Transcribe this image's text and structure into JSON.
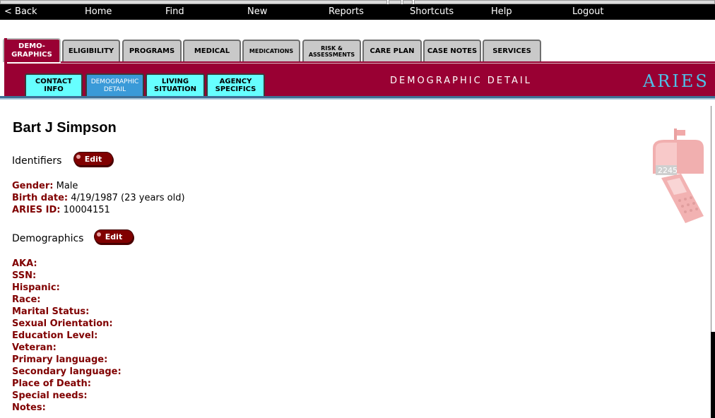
{
  "menubar": {
    "back": "< Back",
    "home": "Home",
    "find": "Find",
    "new": "New",
    "reports": "Reports",
    "shortcuts": "Shortcuts",
    "help": "Help",
    "logout": "Logout"
  },
  "tabs": {
    "demographics_1": "DEMO-",
    "demographics_2": "GRAPHICS",
    "eligibility": "ELIGIBILITY",
    "programs": "PROGRAMS",
    "medical": "MEDICAL",
    "medications": "MEDICATIONS",
    "risk_1": "RISK &",
    "risk_2": "ASSESSMENTS",
    "care_plan": "CARE PLAN",
    "case_notes": "CASE NOTES",
    "services": "SERVICES"
  },
  "subtabs": {
    "contact_1": "CONTACT",
    "contact_2": "INFO",
    "demographic_1": "DEMOGRAPHIC",
    "demographic_2": "DETAIL",
    "living_1": "LIVING",
    "living_2": "SITUATION",
    "agency_1": "AGENCY",
    "agency_2": "SPECIFICS"
  },
  "section_title": "DEMOGRAPHIC DETAIL",
  "brand": "ARIES",
  "client": {
    "name": "Bart J Simpson"
  },
  "identifiers": {
    "heading": "Identifiers",
    "edit_label": "Edit",
    "gender_label": "Gender:",
    "gender_value": "Male",
    "birth_label": "Birth date:",
    "birth_value": "4/19/1987 (23 years old)",
    "aries_id_label": "ARIES ID:",
    "aries_id_value": "10004151"
  },
  "demographics": {
    "heading": "Demographics",
    "edit_label": "Edit",
    "aka": "AKA:",
    "ssn": "SSN:",
    "hispanic": "Hispanic:",
    "race": "Race:",
    "marital": "Marital Status:",
    "orientation": "Sexual Orientation:",
    "education": "Education Level:",
    "veteran": "Veteran:",
    "primary_lang": "Primary language:",
    "secondary_lang": "Secondary language:",
    "place_of_death": "Place of Death:",
    "special_needs": "Special needs:",
    "notes": "Notes:"
  },
  "mailbox_number": "2245",
  "colors": {
    "maroon": "#990033",
    "label": "#800000",
    "cyan_tab": "#66ffff",
    "active_subtab": "#3a9ad8",
    "brand": "#4ec0e8"
  }
}
